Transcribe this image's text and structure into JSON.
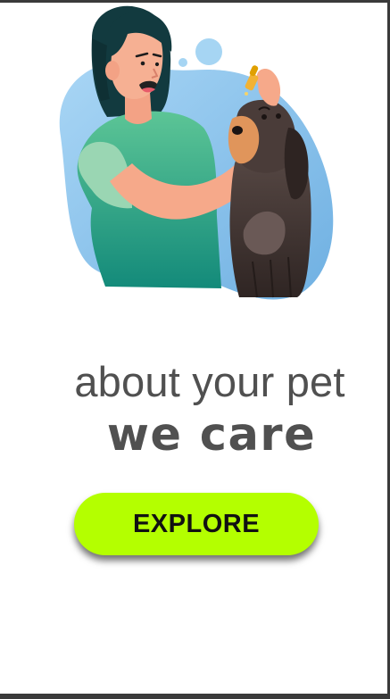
{
  "hero": {
    "illustration": "woman-giving-eye-drops-to-dog",
    "colors": {
      "blob": "#8ec3ea",
      "hair": "#123a3f",
      "skin": "#f6a98a",
      "shirt": "#2ea88a",
      "dog": "#4a3c39",
      "dog_face": "#e0955b"
    }
  },
  "headline": {
    "line1": "about your pet",
    "line2": "we care"
  },
  "cta": {
    "label": "EXPLORE",
    "color": "#b4ff00"
  }
}
